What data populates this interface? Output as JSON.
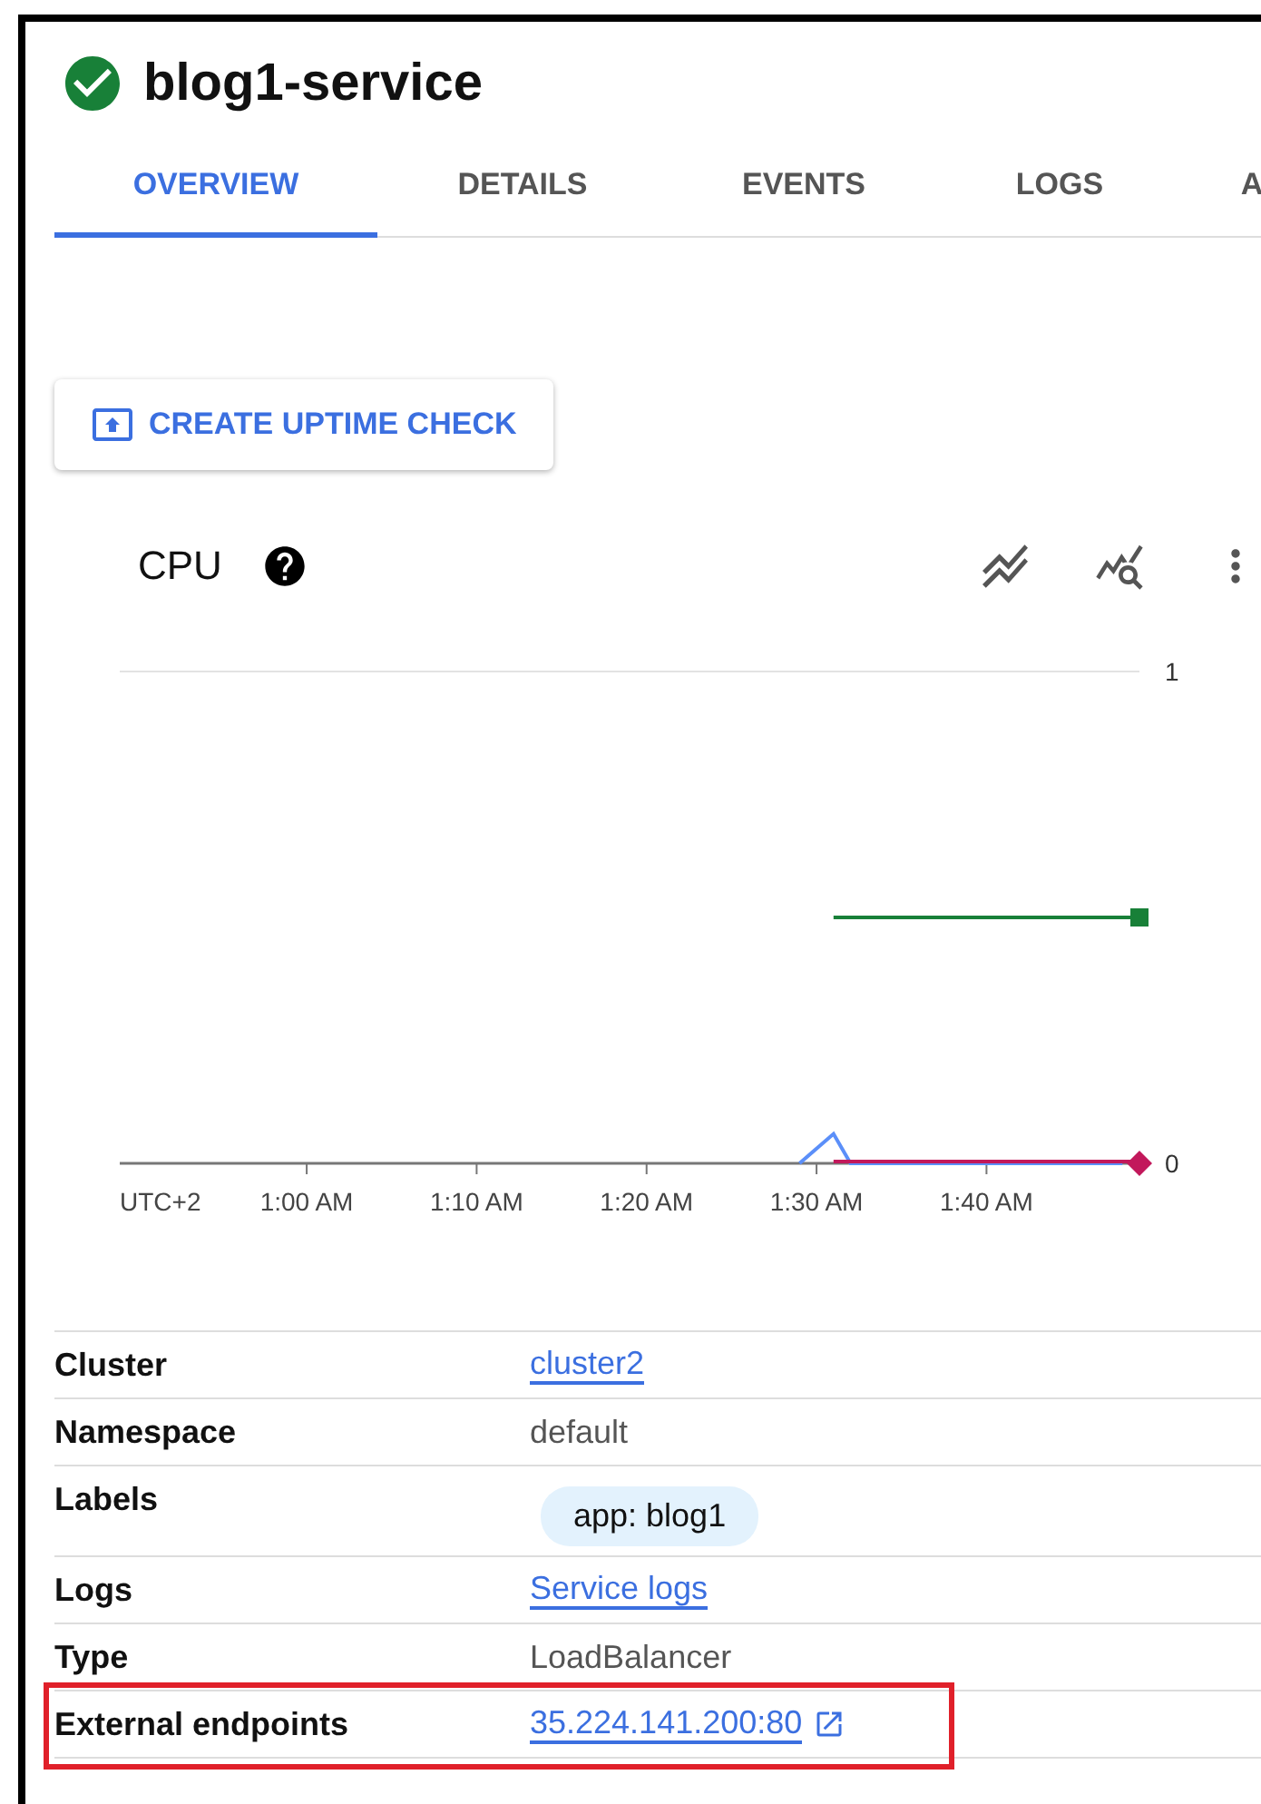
{
  "header": {
    "title": "blog1-service"
  },
  "tabs": [
    {
      "label": "OVERVIEW",
      "selected": true
    },
    {
      "label": "DETAILS",
      "selected": false
    },
    {
      "label": "EVENTS",
      "selected": false
    },
    {
      "label": "LOGS",
      "selected": false
    },
    {
      "label": "A",
      "selected": false
    }
  ],
  "uptime_button": {
    "label": "CREATE UPTIME CHECK"
  },
  "cpu_card": {
    "title": "CPU",
    "timezone": "UTC+2",
    "chart_data": {
      "type": "line",
      "categories": [
        null,
        null,
        null,
        null,
        null,
        null,
        null,
        null,
        null,
        null,
        null,
        "1:00 AM",
        null,
        null,
        null,
        null,
        null,
        null,
        null,
        null,
        null,
        "1:10 AM",
        null,
        null,
        null,
        null,
        null,
        null,
        null,
        null,
        null,
        "1:20 AM",
        null,
        null,
        null,
        null,
        null,
        null,
        null,
        null,
        null,
        "1:30 AM",
        null,
        null,
        null,
        null,
        null,
        null,
        null,
        null,
        null,
        "1:40 AM",
        null,
        null,
        null,
        null,
        null,
        null,
        null,
        null,
        null
      ],
      "series": [
        {
          "color": "#5b8ff9",
          "values": [
            null,
            null,
            null,
            null,
            null,
            null,
            null,
            null,
            null,
            null,
            null,
            null,
            null,
            null,
            null,
            null,
            null,
            null,
            null,
            null,
            null,
            null,
            null,
            null,
            null,
            null,
            null,
            null,
            null,
            null,
            null,
            null,
            null,
            null,
            null,
            null,
            null,
            null,
            null,
            null,
            0,
            0.03,
            0.06,
            0,
            0,
            0,
            0,
            0,
            0,
            0,
            0,
            0,
            0,
            0,
            0,
            0,
            0,
            0,
            0,
            0,
            null
          ]
        },
        {
          "color": "#188038",
          "values": [
            null,
            null,
            null,
            null,
            null,
            null,
            null,
            null,
            null,
            null,
            null,
            null,
            null,
            null,
            null,
            null,
            null,
            null,
            null,
            null,
            null,
            null,
            null,
            null,
            null,
            null,
            null,
            null,
            null,
            null,
            null,
            null,
            null,
            null,
            null,
            null,
            null,
            null,
            null,
            null,
            null,
            null,
            0.5,
            0.5,
            0.5,
            0.5,
            0.5,
            0.5,
            0.5,
            0.5,
            0.5,
            0.5,
            0.5,
            0.5,
            0.5,
            0.5,
            0.5,
            0.5,
            0.5,
            0.5,
            0.5
          ]
        },
        {
          "color": "#c2185b",
          "values": [
            null,
            null,
            null,
            null,
            null,
            null,
            null,
            null,
            null,
            null,
            null,
            null,
            null,
            null,
            null,
            null,
            null,
            null,
            null,
            null,
            null,
            null,
            null,
            null,
            null,
            null,
            null,
            null,
            null,
            null,
            null,
            null,
            null,
            null,
            null,
            null,
            null,
            null,
            null,
            null,
            null,
            null,
            0,
            0,
            0,
            0,
            0,
            0,
            0,
            0,
            0,
            0,
            0,
            0,
            0,
            0,
            0,
            0,
            0,
            0,
            0
          ]
        }
      ],
      "ylim": [
        0,
        1
      ],
      "yticks": [
        0,
        1
      ]
    }
  },
  "details": [
    {
      "label": "Cluster",
      "value": "cluster2",
      "kind": "link",
      "highlighted": false
    },
    {
      "label": "Namespace",
      "value": "default",
      "kind": "text",
      "highlighted": false
    },
    {
      "label": "Labels",
      "value": "app: blog1",
      "kind": "chip",
      "highlighted": false
    },
    {
      "label": "Logs",
      "value": "Service logs",
      "kind": "link",
      "highlighted": false
    },
    {
      "label": "Type",
      "value": "LoadBalancer",
      "kind": "text",
      "highlighted": false
    },
    {
      "label": "External endpoints",
      "value": "35.224.141.200:80",
      "kind": "external_link",
      "highlighted": true
    }
  ]
}
